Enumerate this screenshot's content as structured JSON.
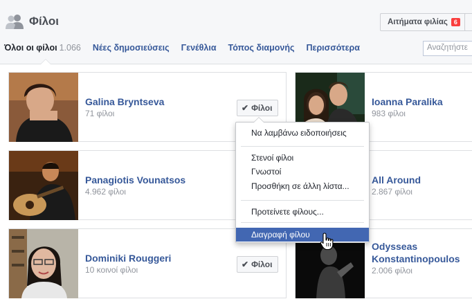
{
  "header": {
    "title": "Φίλοι",
    "requests_label": "Αιτήματα φιλίας",
    "requests_count": "6"
  },
  "tabs": [
    {
      "label": "Όλοι οι φίλοι",
      "count": "1.066"
    },
    {
      "label": "Νέες δημοσιεύσεις"
    },
    {
      "label": "Γενέθλια"
    },
    {
      "label": "Τόπος διαμονής"
    },
    {
      "label": "Περισσότερα"
    }
  ],
  "search": {
    "placeholder": "Αναζητήστε"
  },
  "friends": [
    {
      "name": "Galina Bryntseva",
      "sub": "71 φίλοι",
      "button": "Φίλοι"
    },
    {
      "name": "Ioanna Paralika",
      "sub": "983 φίλοι"
    },
    {
      "name": "Panagiotis Vounatsos",
      "sub": "4.962 φίλοι"
    },
    {
      "name": "All Around",
      "sub": "2.867 φίλοι"
    },
    {
      "name": "Dominiki Rouggeri",
      "sub": "10 κοινοί φίλοι",
      "button": "Φίλοι"
    },
    {
      "name": "Odysseas Konstantinopoulos",
      "sub": "2.006 φίλοι"
    }
  ],
  "menu": {
    "items": [
      "Να λαμβάνω ειδοποιήσεις",
      "Στενοί φίλοι",
      "Γνωστοί",
      "Προσθήκη σε άλλη λίστα...",
      "Προτείνετε φίλους...",
      "Διαγραφή φίλου"
    ],
    "highlighted": "Διαγραφή φίλου"
  },
  "colors": {
    "link": "#365899",
    "badge": "#fa3e3e",
    "highlight": "#4267b2"
  },
  "icons": [
    "friends-icon",
    "check-icon",
    "hand-cursor-icon"
  ]
}
